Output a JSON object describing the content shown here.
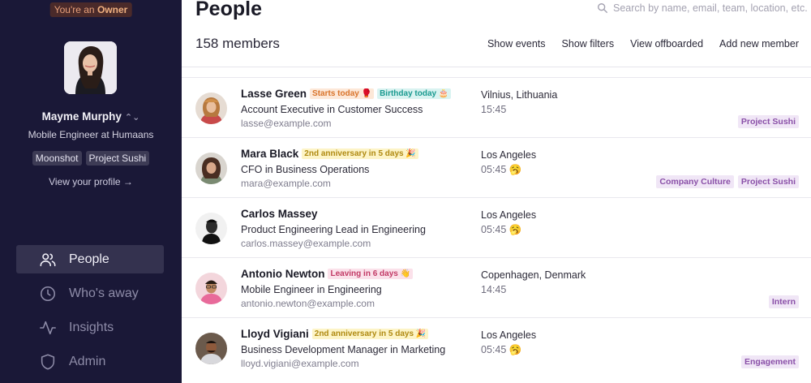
{
  "sidebar": {
    "owner_badge_prefix": "You're an ",
    "owner_badge_role": "Owner",
    "profile": {
      "name": "Mayme Murphy",
      "role": "Mobile Engineer at Humaans",
      "tags": [
        "Moonshot",
        "Project Sushi"
      ],
      "view_link": "View your profile →"
    },
    "nav": [
      {
        "label": "People",
        "icon": "people-icon",
        "active": true
      },
      {
        "label": "Who's away",
        "icon": "clock-icon",
        "active": false
      },
      {
        "label": "Insights",
        "icon": "activity-icon",
        "active": false
      },
      {
        "label": "Admin",
        "icon": "shield-icon",
        "active": false
      }
    ]
  },
  "main": {
    "title": "People",
    "search_placeholder": "Search by name, email, team, location, etc.",
    "members_count": "158 members",
    "actions": [
      "Show events",
      "Show filters",
      "View offboarded",
      "Add new member"
    ],
    "people": [
      {
        "name": "Lasse Green",
        "badges": [
          {
            "text": "Starts today 🥊",
            "color": "orange"
          },
          {
            "text": "Birthday today 🎂",
            "color": "teal"
          }
        ],
        "title": "Account Executive in Customer Success",
        "email": "lasse@example.com",
        "location": "Vilnius, Lithuania",
        "time": "15:45",
        "tags": [
          "Project Sushi"
        ]
      },
      {
        "name": "Mara Black",
        "badges": [
          {
            "text": "2nd anniversary in 5 days 🎉",
            "color": "yellow"
          }
        ],
        "title": "CFO in Business Operations",
        "email": "mara@example.com",
        "location": "Los Angeles",
        "time": "05:45 🥱",
        "tags": [
          "Company Culture",
          "Project Sushi"
        ]
      },
      {
        "name": "Carlos Massey",
        "badges": [],
        "title": "Product Engineering Lead in Engineering",
        "email": "carlos.massey@example.com",
        "location": "Los Angeles",
        "time": "05:45 🥱",
        "tags": []
      },
      {
        "name": "Antonio Newton",
        "badges": [
          {
            "text": "Leaving in 6 days 👋",
            "color": "red"
          }
        ],
        "title": "Mobile Engineer in Engineering",
        "email": "antonio.newton@example.com",
        "location": "Copenhagen, Denmark",
        "time": "14:45",
        "tags": [
          "Intern"
        ]
      },
      {
        "name": "Lloyd Vigiani",
        "badges": [
          {
            "text": "2nd anniversary in 5 days 🎉",
            "color": "yellow"
          }
        ],
        "title": "Business Development Manager in Marketing",
        "email": "lloyd.vigiani@example.com",
        "location": "Los Angeles",
        "time": "05:45 🥱",
        "tags": [
          "Engagement"
        ]
      }
    ]
  }
}
